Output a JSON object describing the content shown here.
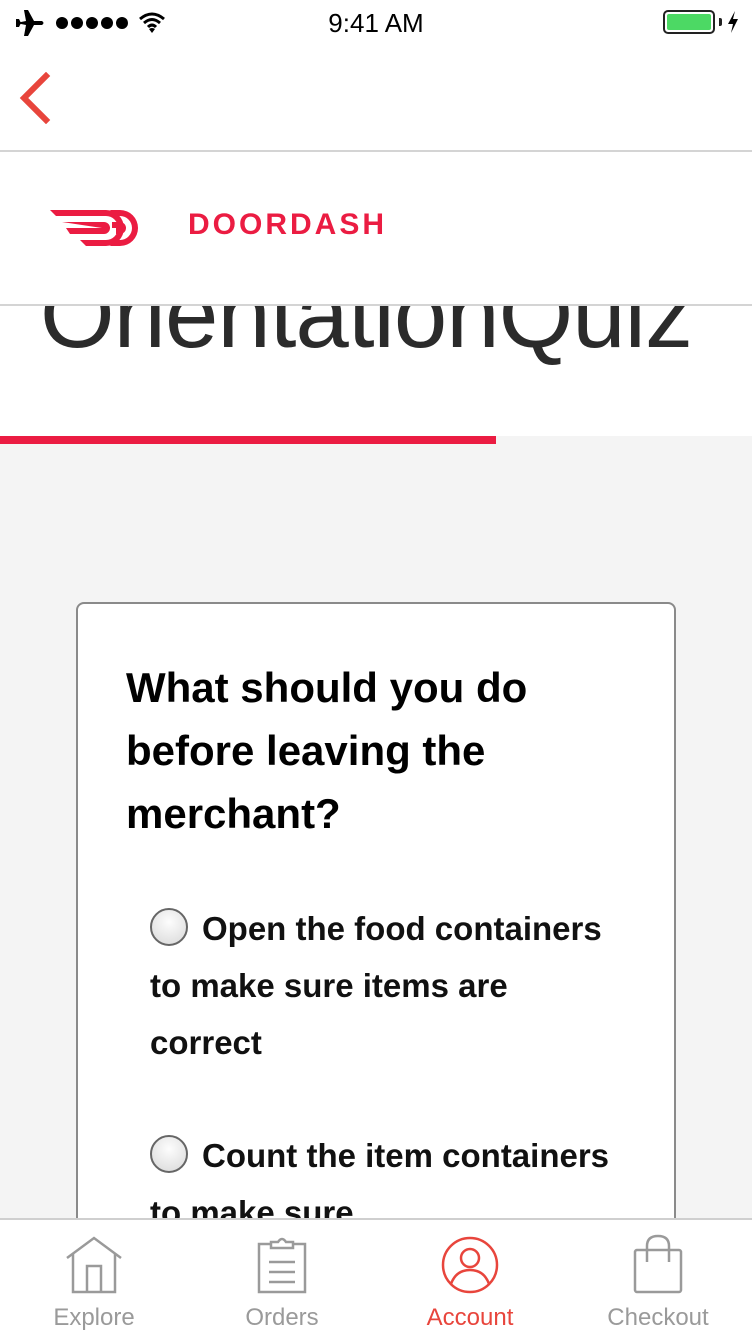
{
  "status_bar": {
    "time": "9:41 AM",
    "airplane_icon": "airplane-icon",
    "signal_bars": 5,
    "wifi_icon": "wifi-icon",
    "battery_level": 1.0,
    "charging_icon": "bolt-icon"
  },
  "nav": {
    "back_icon": "chevron-left-icon"
  },
  "brand": {
    "name": "DOORDASH",
    "logo_icon": "doordash-logo-icon",
    "color": "#eb1c42"
  },
  "quiz": {
    "title": "OrientationQuiz",
    "progress": 0.66,
    "question": "What should you do before leaving the merchant?",
    "options": [
      {
        "label": "Open the food containers to make sure items are correct",
        "selected": false
      },
      {
        "label": "Count the item containers to make sure",
        "selected": false
      }
    ]
  },
  "tab_bar": {
    "active_color": "#e8453c",
    "items": [
      {
        "label": "Explore",
        "icon": "house-icon",
        "active": false
      },
      {
        "label": "Orders",
        "icon": "clipboard-icon",
        "active": false
      },
      {
        "label": "Account",
        "icon": "user-circle-icon",
        "active": true
      },
      {
        "label": "Checkout",
        "icon": "shopping-bag-icon",
        "active": false
      }
    ]
  }
}
